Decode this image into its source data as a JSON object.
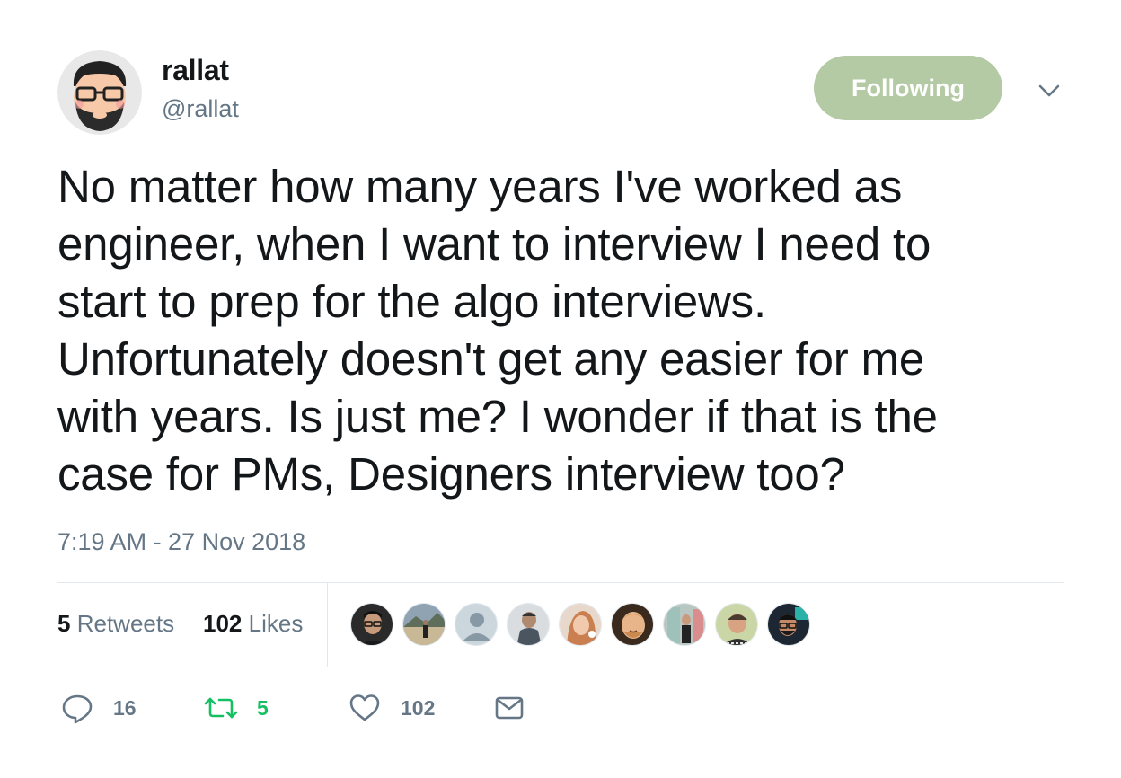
{
  "author": {
    "display_name": "rallat",
    "handle": "@rallat"
  },
  "follow_button": {
    "label": "Following",
    "color": "#b4caa5"
  },
  "menu": {
    "icon": "chevron-down-icon"
  },
  "tweet": {
    "lines": [
      "No matter how many years I've worked as",
      "engineer, when I want to interview I need to",
      "start to prep for the algo interviews.",
      "Unfortunately doesn't get any easier for me",
      "with years. Is just me? I wonder if that is the",
      "case for PMs, Designers interview too?"
    ],
    "timestamp": "7:19 AM - 27 Nov 2018"
  },
  "stats": {
    "retweets_count": "5",
    "retweets_label": "Retweets",
    "likes_count": "102",
    "likes_label": "Likes"
  },
  "likers": [
    {
      "icon": "avatar"
    },
    {
      "icon": "avatar"
    },
    {
      "icon": "avatar"
    },
    {
      "icon": "avatar"
    },
    {
      "icon": "avatar"
    },
    {
      "icon": "avatar"
    },
    {
      "icon": "avatar"
    },
    {
      "icon": "avatar"
    },
    {
      "icon": "avatar"
    }
  ],
  "actions": {
    "reply_count": "16",
    "retweet_count": "5",
    "like_count": "102",
    "retweet_color": "#17bf63"
  }
}
